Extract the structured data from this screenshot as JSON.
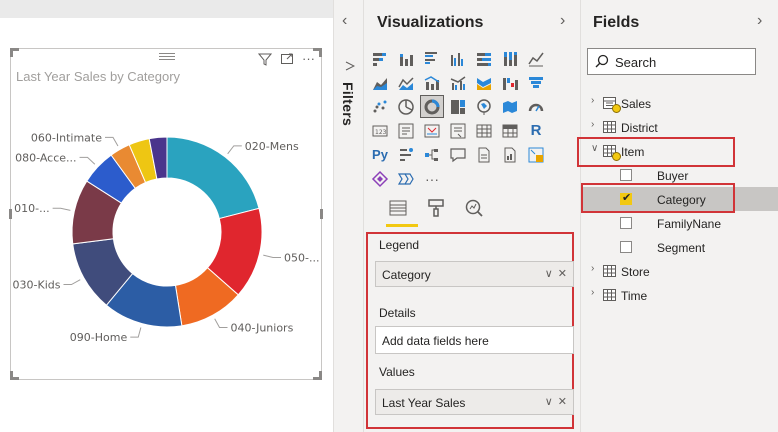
{
  "visual": {
    "title": "Last Year Sales by Category",
    "tools": [
      "filter-icon",
      "focus-mode-icon",
      "more-options-icon"
    ],
    "more_glyph": "···"
  },
  "chart_data": {
    "type": "pie",
    "subtype": "donut",
    "title": "Last Year Sales by Category",
    "slices": [
      {
        "label": "020-Mens",
        "value": 21,
        "color": "#2aa3bf"
      },
      {
        "label": "050-...",
        "value": 15.5,
        "color": "#e0262e"
      },
      {
        "label": "040-Juniors",
        "value": 11,
        "color": "#ef6a22"
      },
      {
        "label": "090-Home",
        "value": 13.5,
        "color": "#2c5da5"
      },
      {
        "label": "030-Kids",
        "value": 12,
        "color": "#404c7c"
      },
      {
        "label": "010-...",
        "value": 11,
        "color": "#7a3a48"
      },
      {
        "label": "080-Acce...",
        "value": 6,
        "color": "#2c5ccc"
      },
      {
        "label": "060-Intimate",
        "value": 3.5,
        "color": "#e98a32"
      },
      {
        "label": "",
        "value": 3.5,
        "color": "#eec613"
      },
      {
        "label": "",
        "value": 3,
        "color": "#4a358c"
      }
    ],
    "legend": "none"
  },
  "filters": {
    "label": "Filters",
    "chevron": "‹"
  },
  "visualizations": {
    "title": "Visualizations",
    "chevron": "›",
    "selected_icon": "donut-chart-visual-icon",
    "tabs": [
      "fields-tab",
      "format-tab",
      "analytics-tab"
    ],
    "more_glyph": "···",
    "r_label": "R",
    "py_label": "Py",
    "wells": {
      "legend_label": "Legend",
      "legend_value": "Category",
      "details_label": "Details",
      "details_placeholder": "Add data fields here",
      "values_label": "Values",
      "values_value": "Last Year Sales",
      "chevron_glyph": "∨",
      "remove_glyph": "✕"
    }
  },
  "fields": {
    "title": "Fields",
    "chevron": "›",
    "search_placeholder": "Search",
    "tables": [
      {
        "name": "Sales",
        "expanded": false
      },
      {
        "name": "District",
        "expanded": false
      },
      {
        "name": "Item",
        "expanded": true
      },
      {
        "name": "Store",
        "expanded": false
      },
      {
        "name": "Time",
        "expanded": false
      }
    ],
    "item_fields": [
      {
        "name": "Buyer",
        "checked": false
      },
      {
        "name": "Category",
        "checked": true
      },
      {
        "name": "FamilyNane",
        "checked": false
      },
      {
        "name": "Segment",
        "checked": false
      }
    ],
    "collapsed_glyph": "›",
    "expanded_glyph": "∨",
    "check_glyph": "✔"
  },
  "colors": {
    "accent": "#f2c811",
    "highlight": "#d13438",
    "pane_bg": "#f3f2f1"
  }
}
